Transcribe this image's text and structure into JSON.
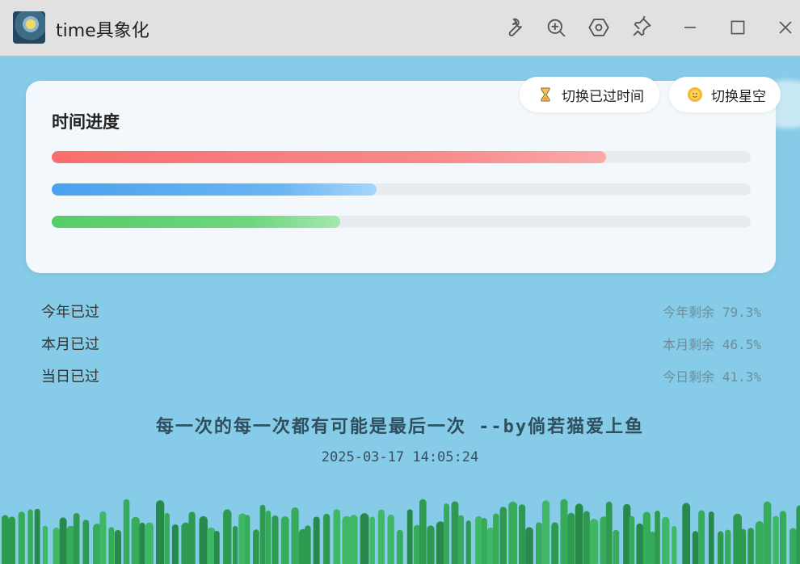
{
  "window": {
    "title": "time具象化",
    "toolbar_icons": [
      "wrench-icon",
      "zoom-in-icon",
      "hexagon-settings-icon",
      "pin-icon"
    ],
    "controls": [
      "minimize-icon",
      "maximize-icon",
      "close-icon"
    ]
  },
  "card": {
    "title": "时间进度",
    "progress": [
      {
        "name": "year",
        "elapsed_percent": 79.3
      },
      {
        "name": "month",
        "elapsed_percent": 46.5
      },
      {
        "name": "day",
        "elapsed_percent": 41.3
      }
    ],
    "toggle_elapsed_label": "切换已过时间",
    "toggle_starry_label": "切换星空"
  },
  "stats": [
    {
      "label": "今年已过",
      "remain_label": "今年剩余",
      "remain_value": "79.3%"
    },
    {
      "label": "本月已过",
      "remain_label": "本月剩余",
      "remain_value": "46.5%"
    },
    {
      "label": "当日已过",
      "remain_label": "今日剩余",
      "remain_value": "41.3%"
    }
  ],
  "quote": "每一次的每一次都有可能是最后一次 --by倘若猫爱上鱼",
  "datetime": "2025-03-17 14:05:24",
  "colors": {
    "background": "#86cbe8",
    "year_bar": "#f96e6e",
    "month_bar": "#4aa2f0",
    "day_bar": "#55cd68",
    "grass": "#2e9a4f"
  }
}
